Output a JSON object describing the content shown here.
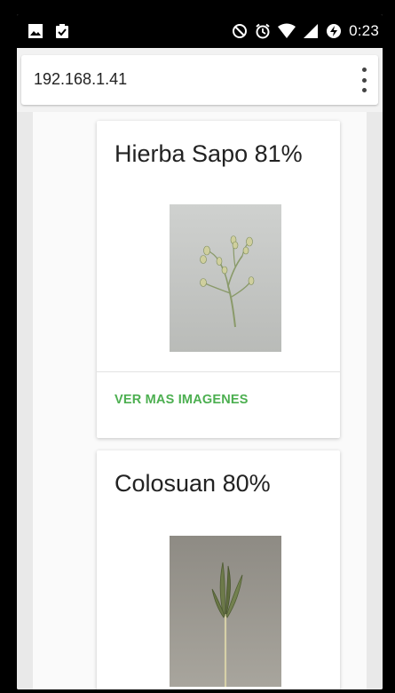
{
  "status_bar": {
    "time": "0:23",
    "icons_left": [
      "image-icon",
      "clipboard-check-icon"
    ],
    "icons_right": [
      "do-not-disturb-icon",
      "alarm-icon",
      "wifi-icon",
      "signal-icon",
      "battery-charging-icon"
    ]
  },
  "browser": {
    "url": "192.168.1.41",
    "menu_icon": "more-vert-icon"
  },
  "cards": [
    {
      "title": "Hierba Sapo 81%",
      "image": "plant-photo-hierba-sapo",
      "action_label": "VER MAS IMAGENES"
    },
    {
      "title": "Colosuan 80%",
      "image": "plant-photo-colosuan"
    }
  ],
  "colors": {
    "accent_green": "#4caf50",
    "status_bar": "#000000"
  }
}
